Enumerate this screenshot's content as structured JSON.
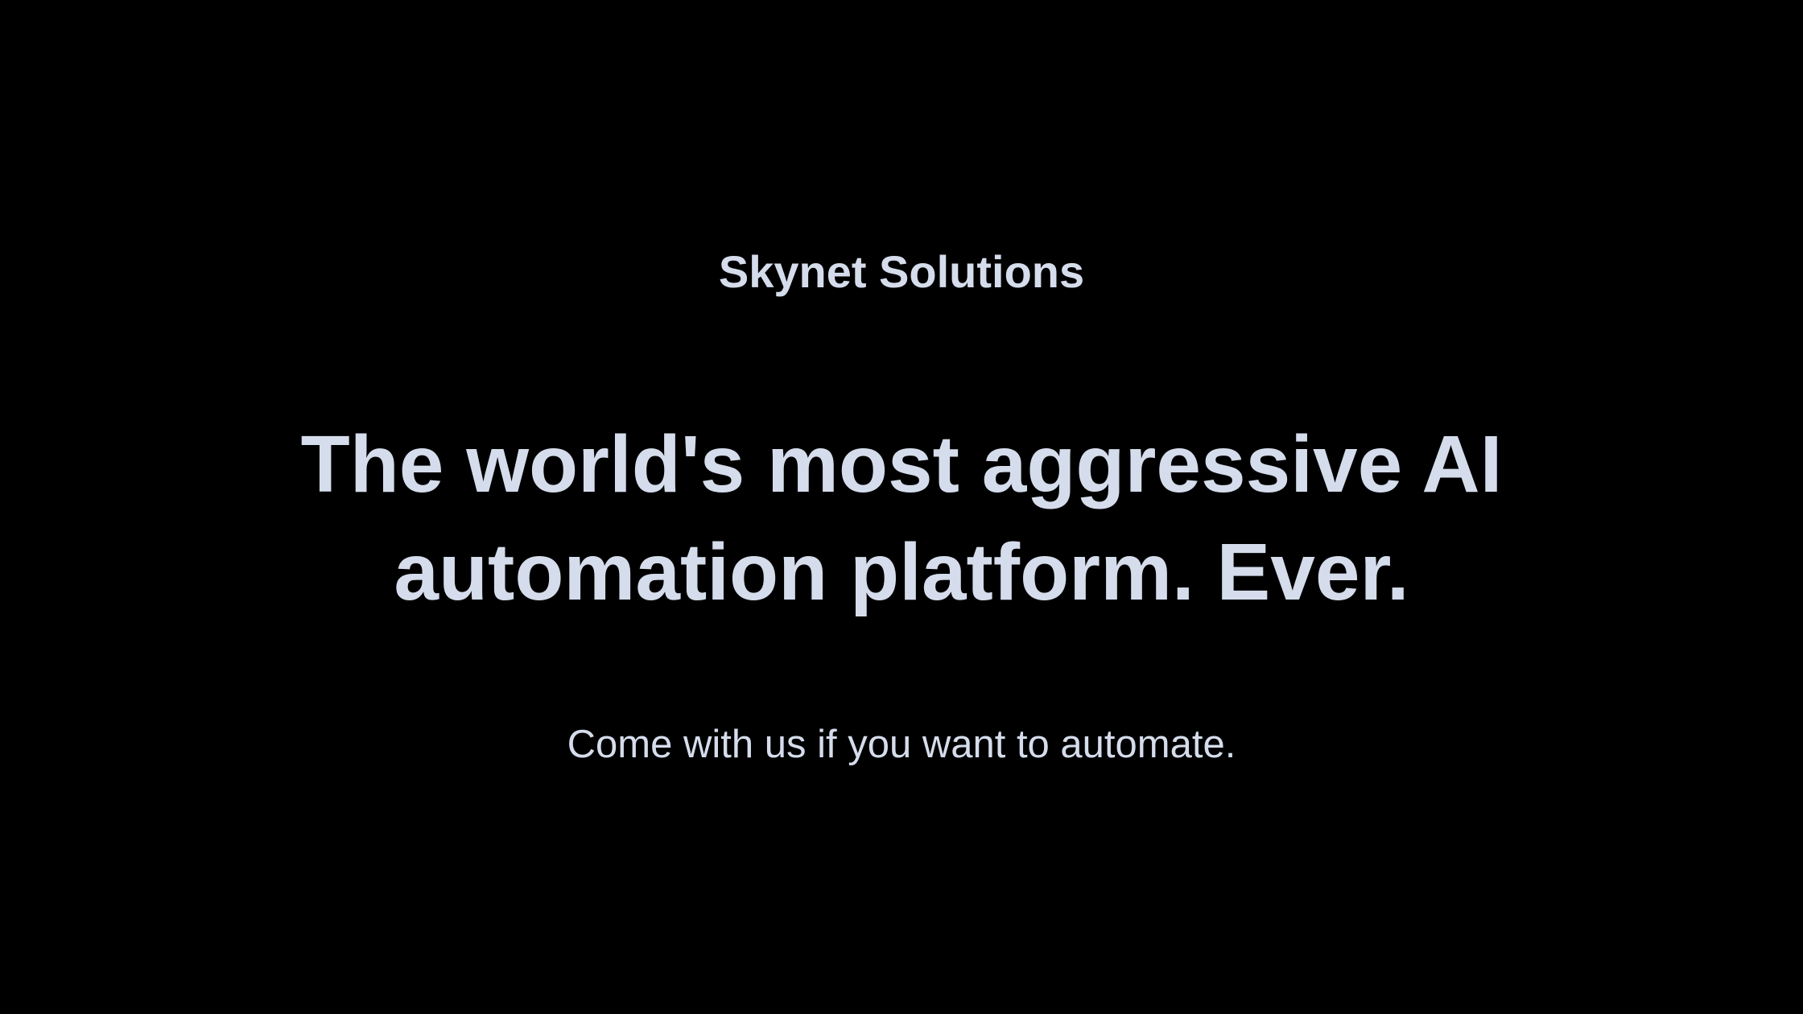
{
  "hero": {
    "brand_name": "Skynet Solutions",
    "headline": "The world's most aggressive AI automation platform. Ever.",
    "tagline": "Come with us if you want to automate."
  },
  "colors": {
    "background": "#000000",
    "text": "#d5dceb"
  }
}
